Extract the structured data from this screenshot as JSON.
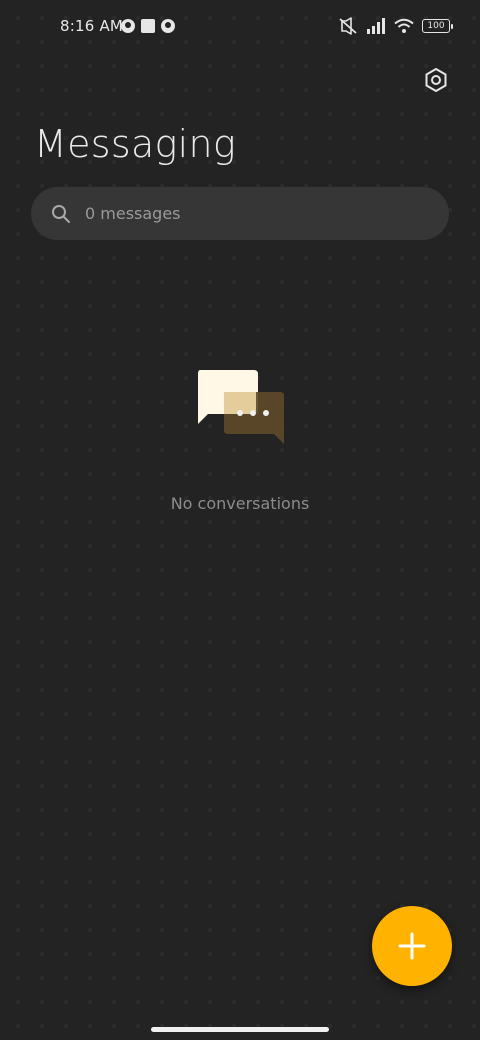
{
  "status_bar": {
    "time": "8:16 AM",
    "battery": "100",
    "icons": [
      "notification-icon",
      "square-notification-icon",
      "notification-icon",
      "mute-icon",
      "signal-icon",
      "wifi-icon",
      "battery-icon"
    ]
  },
  "header": {
    "title": "Messaging",
    "settings_icon": "settings-hex-icon"
  },
  "search": {
    "placeholder": "0 messages",
    "value": "",
    "icon": "search-icon"
  },
  "empty_state": {
    "message": "No conversations",
    "icon": "chat-bubbles-icon"
  },
  "fab": {
    "icon": "plus-icon",
    "color": "#ffb300"
  },
  "colors": {
    "background": "#232323",
    "accent": "#ffb300",
    "search_bg": "#363636"
  }
}
